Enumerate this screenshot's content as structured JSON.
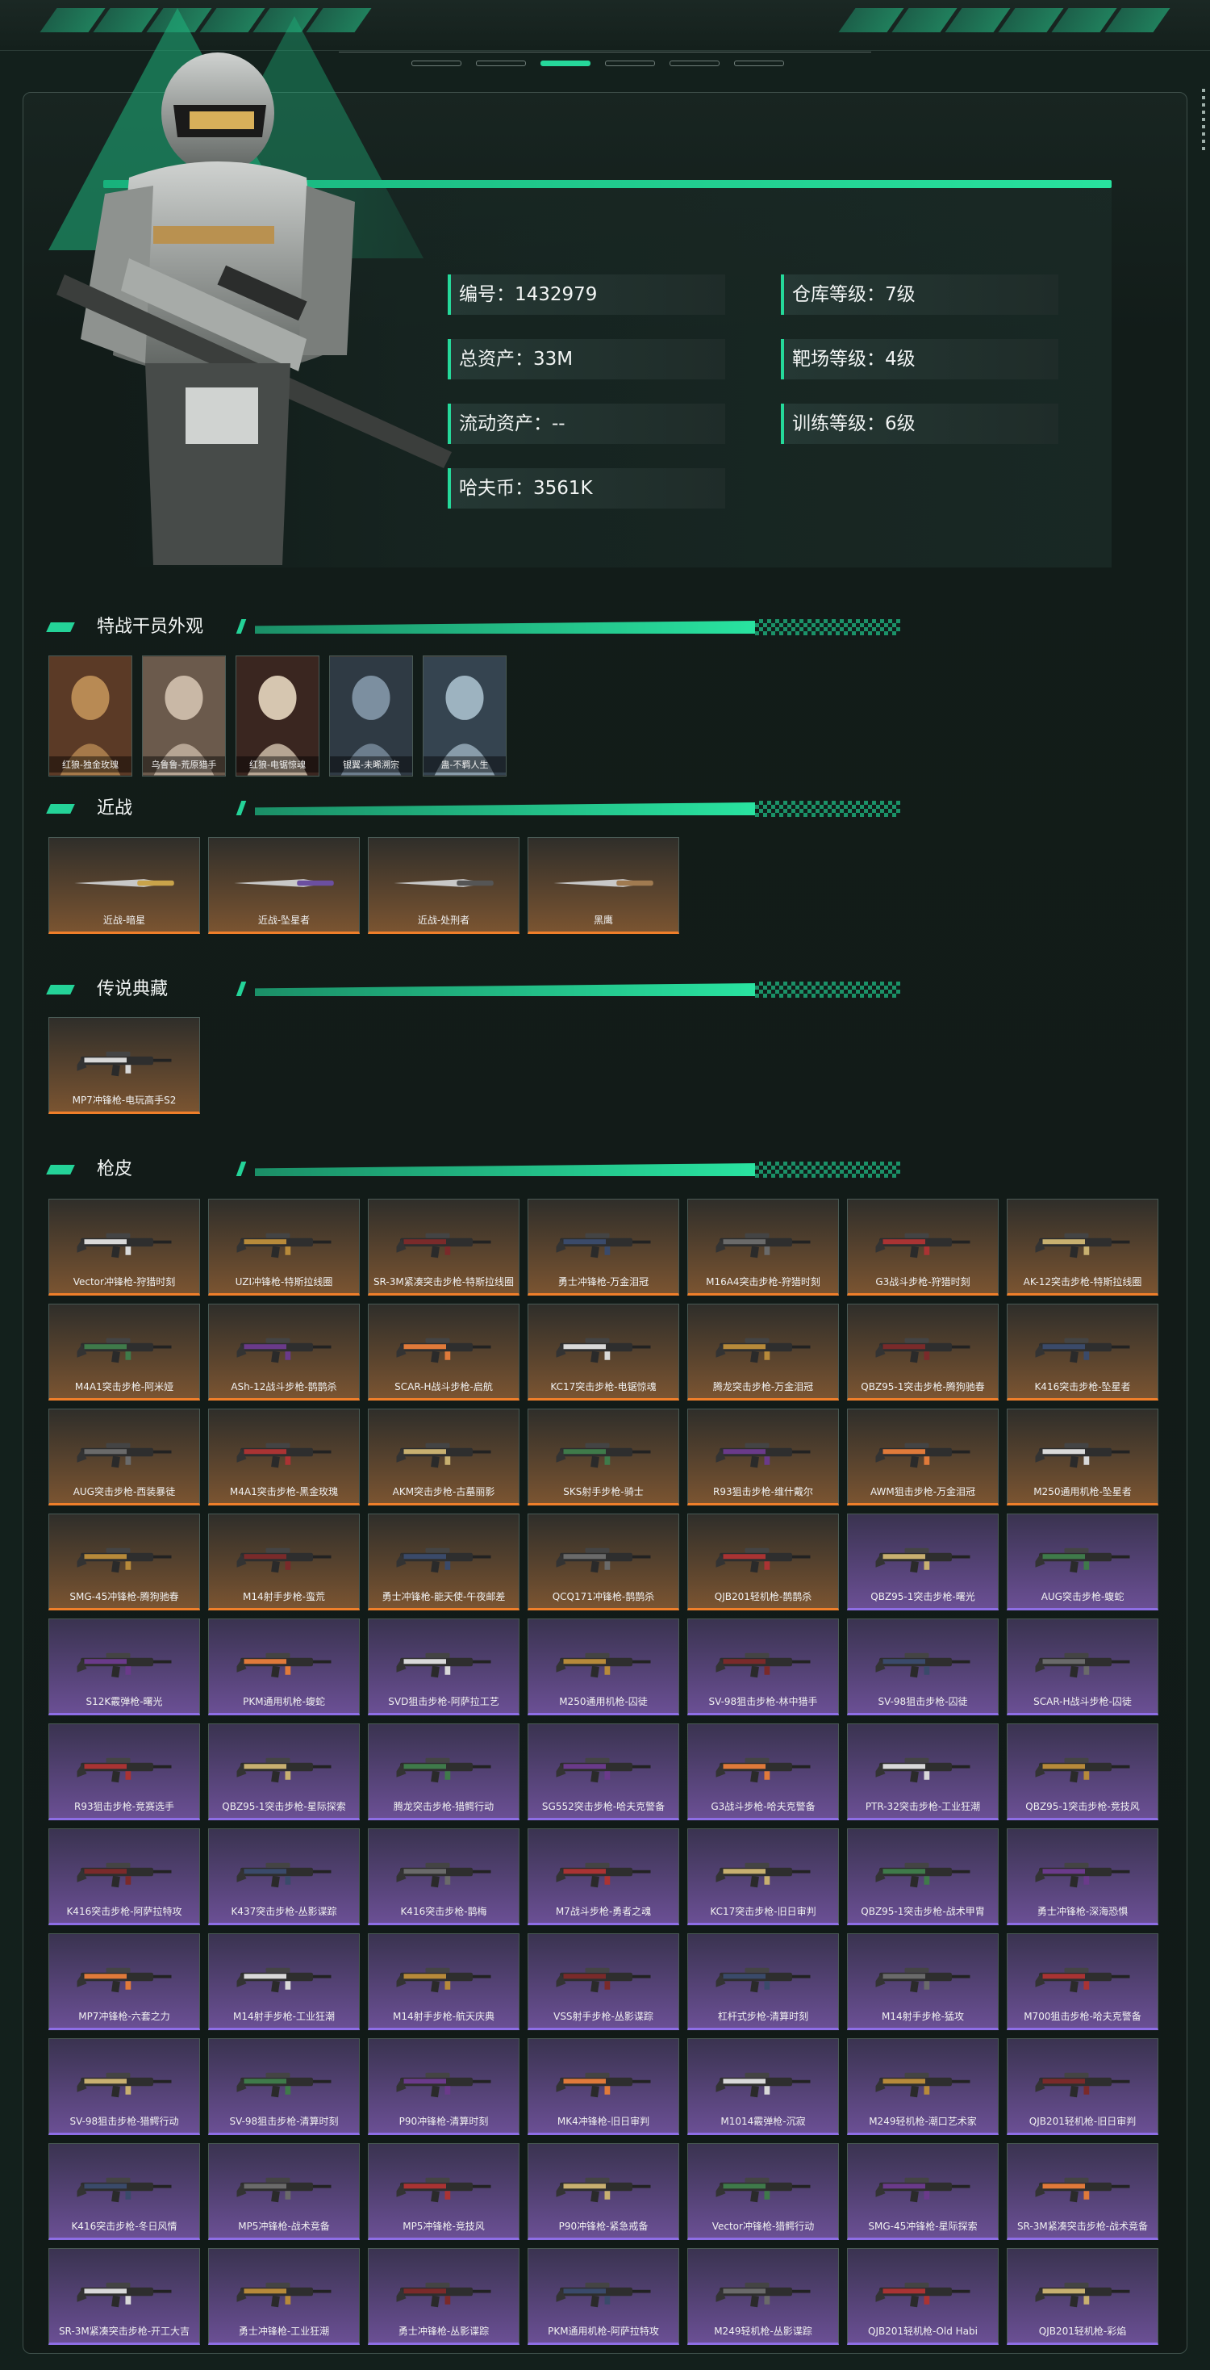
{
  "profile": {
    "stats": [
      {
        "label": "编号：1432979"
      },
      {
        "label": "仓库等级：7级"
      },
      {
        "label": "总资产：33M"
      },
      {
        "label": "靶场等级：4级"
      },
      {
        "label": "流动资产：--"
      },
      {
        "label": "训练等级：6级"
      },
      {
        "label": "哈夫币：3561K"
      }
    ]
  },
  "sections": {
    "operators": "特战干员外观",
    "melee": "近战",
    "legend": "传说典藏",
    "skins": "枪皮"
  },
  "operators": [
    "红狼-独金玫瑰",
    "乌鲁鲁-荒原猎手",
    "红狼-电锯惊魂",
    "银翼-未晞溯宗",
    "蛊-不羁人生"
  ],
  "melee": [
    "近战-暗星",
    "近战-坠星者",
    "近战-处刑者",
    "黑鹰"
  ],
  "legend": [
    "MP7冲锋枪-电玩高手S2"
  ],
  "skins": [
    "Vector冲锋枪-狩猎时刻",
    "UZI冲锋枪-特斯拉线圈",
    "SR-3M紧凑突击步枪-特斯拉线圈",
    "勇士冲锋枪-万金泪冠",
    "M16A4突击步枪-狩猎时刻",
    "G3战斗步枪-狩猎时刻",
    "AK-12突击步枪-特斯拉线圈",
    "M4A1突击步枪-阿米娅",
    "ASh-12战斗步枪-鹊鹊杀",
    "SCAR-H战斗步枪-启航",
    "KC17突击步枪-电锯惊魂",
    "腾龙突击步枪-万金泪冠",
    "QBZ95-1突击步枪-腾狗驰春",
    "K416突击步枪-坠星者",
    "AUG突击步枪-西装暴徒",
    "M4A1突击步枪-黑金玫瑰",
    "AKM突击步枪-古墓丽影",
    "SKS射手步枪-骑士",
    "R93狙击步枪-维什戴尔",
    "AWM狙击步枪-万金泪冠",
    "M250通用机枪-坠星者",
    "SMG-45冲锋枪-腾狗驰春",
    "M14射手步枪-蛮荒",
    "勇士冲锋枪-能天使-午夜邮差",
    "QCQ171冲锋枪-鹊鹊杀",
    "QJB201轻机枪-鹊鹊杀",
    "QBZ95-1突击步枪-曙光",
    "AUG突击步枪-蝮蛇",
    "S12K霰弹枪-曙光",
    "PKM通用机枪-蝮蛇",
    "SVD狙击步枪-阿萨拉工艺",
    "M250通用机枪-囚徒",
    "SV-98狙击步枪-林中猎手",
    "SV-98狙击步枪-囚徒",
    "SCAR-H战斗步枪-囚徒",
    "R93狙击步枪-竞赛选手",
    "QBZ95-1突击步枪-星际探索",
    "腾龙突击步枪-猎鳄行动",
    "SG552突击步枪-哈夫克警备",
    "G3战斗步枪-哈夫克警备",
    "PTR-32突击步枪-工业狂潮",
    "QBZ95-1突击步枪-竞技风",
    "K416突击步枪-阿萨拉特攻",
    "K437突击步枪-丛影谍踪",
    "K416突击步枪-鹊梅",
    "M7战斗步枪-勇者之魂",
    "KC17突击步枪-旧日审判",
    "QBZ95-1突击步枪-战术甲胄",
    "勇士冲锋枪-深海恐惧",
    "MP7冲锋枪-六套之力",
    "M14射手步枪-工业狂潮",
    "M14射手步枪-航天庆典",
    "VSS射手步枪-丛影谍踪",
    "杠杆式步枪-清算时刻",
    "M14射手步枪-猛攻",
    "M700狙击步枪-哈夫克警备",
    "SV-98狙击步枪-猎鳄行动",
    "SV-98狙击步枪-清算时刻",
    "P90冲锋枪-清算时刻",
    "MK4冲锋枪-旧日审判",
    "M1014霰弹枪-沉寂",
    "M249轻机枪-潮口艺术家",
    "QJB201轻机枪-旧日审判",
    "K416突击步枪-冬日风情",
    "MP5冲锋枪-战术竞备",
    "MP5冲锋枪-竞技风",
    "P90冲锋枪-紧急戒备",
    "Vector冲锋枪-猎鳄行动",
    "SMG-45冲锋枪-星际探索",
    "SR-3M紧凑突击步枪-战术竞备",
    "SR-3M紧凑突击步枪-开工大吉",
    "勇士冲锋枪-工业狂潮",
    "勇士冲锋枪-丛影谍踪",
    "PKM通用机枪-阿萨拉特攻",
    "M249轻机枪-丛影谍踪",
    "QJB201轻机枪-Old Habi",
    "QJB201轻机枪-彩焰"
  ],
  "skin_rarity": [
    "gold",
    "gold",
    "gold",
    "gold",
    "gold",
    "gold",
    "gold",
    "gold",
    "gold",
    "gold",
    "gold",
    "gold",
    "gold",
    "gold",
    "gold",
    "gold",
    "gold",
    "gold",
    "gold",
    "gold",
    "gold",
    "gold",
    "gold",
    "gold",
    "gold",
    "gold",
    "purple",
    "purple",
    "purple",
    "purple",
    "purple",
    "purple",
    "purple",
    "purple",
    "purple",
    "purple",
    "purple",
    "purple",
    "purple",
    "purple",
    "purple",
    "purple",
    "purple",
    "purple",
    "purple",
    "purple",
    "purple",
    "purple",
    "purple",
    "purple",
    "purple",
    "purple",
    "purple",
    "purple",
    "purple",
    "purple",
    "purple",
    "purple",
    "purple",
    "purple",
    "purple",
    "purple",
    "purple",
    "purple",
    "purple",
    "purple",
    "purple",
    "purple",
    "purple",
    "purple",
    "purple",
    "purple",
    "purple",
    "purple",
    "purple",
    "purple",
    "purple"
  ],
  "colors": {
    "accent": "#24d398",
    "gold_border": "#f07f2a",
    "purple_border": "#8e6ee6"
  }
}
